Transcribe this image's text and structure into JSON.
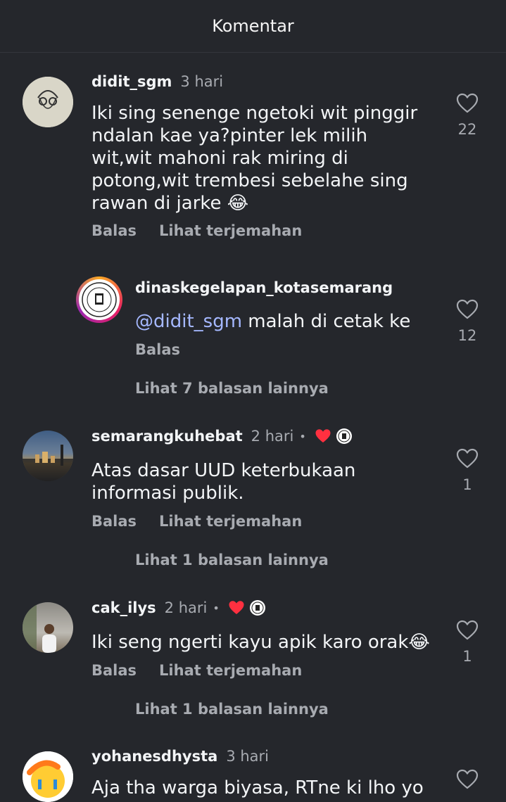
{
  "header": {
    "title": "Komentar"
  },
  "comments": [
    {
      "username": "didit_sgm",
      "time": "3 hari",
      "text": "Iki sing senenge ngetoki wit pinggir ndalan kae ya?pinter lek milih wit,wit mahoni rak miring di potong,wit trembesi sebelahe sing rawan di jarke",
      "emoji": "😂",
      "reply_label": "Balas",
      "translate_label": "Lihat terjemahan",
      "likes": "22"
    },
    {
      "username": "dinaskegelapan_kotasemarang",
      "mention": "@didit_sgm",
      "text": " malah di cetak ke",
      "reply_label": "Balas",
      "likes": "12",
      "more_replies": "Lihat 7 balasan lainnya"
    },
    {
      "username": "semarangkuhebat",
      "time": "2 hari",
      "dot": "•",
      "text": "Atas dasar UUD keterbukaan informasi publik.",
      "reply_label": "Balas",
      "translate_label": "Lihat terjemahan",
      "likes": "1",
      "more_replies": "Lihat 1 balasan lainnya"
    },
    {
      "username": "cak_ilys",
      "time": "2 hari",
      "dot": "•",
      "text": "Iki seng ngerti kayu apik karo orak",
      "emoji": "😂",
      "reply_label": "Balas",
      "translate_label": "Lihat terjemahan",
      "likes": "1",
      "more_replies": "Lihat 1 balasan lainnya"
    },
    {
      "username": "yohanesdhysta",
      "time": "3 hari",
      "text": "Aja tha warga biyasa, RTne ki lho yo"
    }
  ],
  "colors": {
    "background": "#25272c",
    "primary_text": "#f3f5f7",
    "secondary_text": "#a8abb1",
    "mention": "#a5b8ff",
    "heart_red": "#ff3040"
  }
}
